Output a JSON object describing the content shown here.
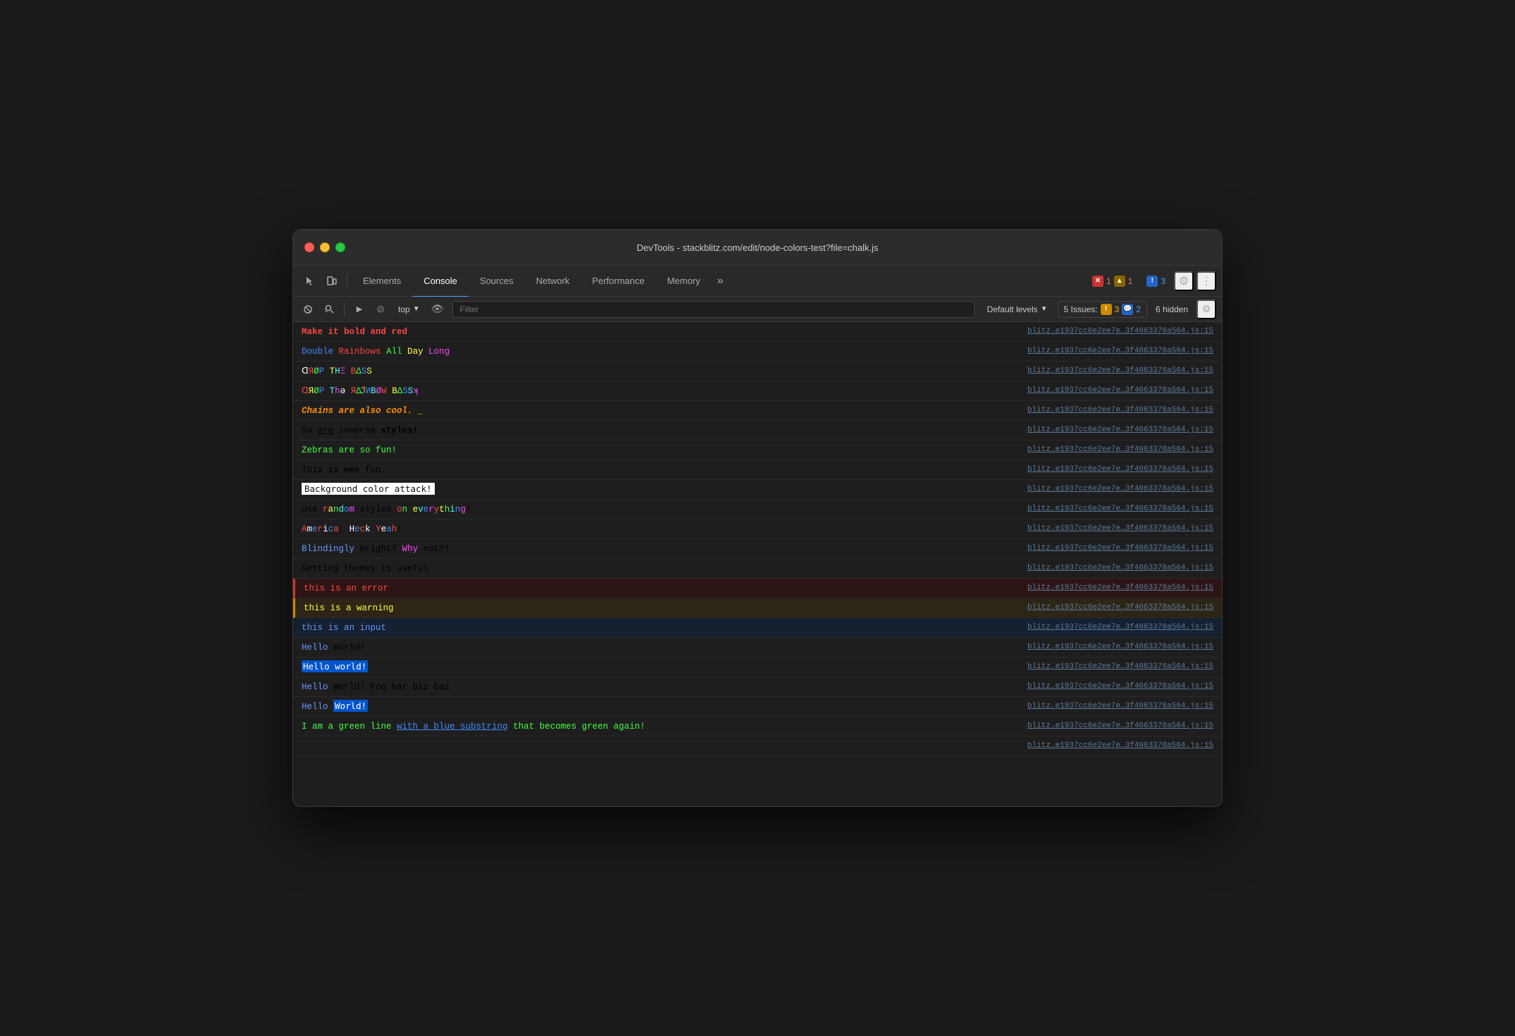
{
  "window": {
    "title": "DevTools - stackblitz.com/edit/node-colors-test?file=chalk.js"
  },
  "tabs": {
    "items": [
      {
        "id": "elements",
        "label": "Elements",
        "active": false
      },
      {
        "id": "console",
        "label": "Console",
        "active": true
      },
      {
        "id": "sources",
        "label": "Sources",
        "active": false
      },
      {
        "id": "network",
        "label": "Network",
        "active": false
      },
      {
        "id": "performance",
        "label": "Performance",
        "active": false
      },
      {
        "id": "memory",
        "label": "Memory",
        "active": false
      }
    ]
  },
  "toolbar": {
    "top_label": "top",
    "filter_placeholder": "Filter",
    "levels_label": "Default levels",
    "issues_label": "5 Issues:",
    "issues_warning_count": "3",
    "issues_info_count": "2",
    "hidden_label": "6 hidden"
  },
  "badges": {
    "error_icon": "✕",
    "error_count": "1",
    "warning_icon": "▲",
    "warning_count": "1",
    "info_icon": "!",
    "info_count": "3"
  },
  "source_link": "blitz.e1937cc6e2ee7e…3f4063378a564.js:15",
  "console_rows": [
    {
      "id": 1,
      "type": "normal",
      "text_html": "<span class='c-red c-bold'>Make it <span class='c-bold'>bold</span> and red</span>"
    },
    {
      "id": 2,
      "type": "normal",
      "text_html": "<span class='c-blue'>Double</span> <span class='c-red'>Rainbows</span> <span class='c-green'>All</span> <span class='c-yellow'>Day</span> <span class='c-magenta'>Long</span>"
    },
    {
      "id": 3,
      "type": "normal",
      "text_html": "<span class='c-white'>ᗡ</span><span class='c-red'>Я</span><span class='c-green'>Ø</span><span class='c-blue'>Ρ</span> <span class='c-yellow'>T</span><span class='c-cyan'>H</span><span class='c-magenta'>Ξ</span> <span class='c-red'>В</span><span class='c-green'>Δ</span><span class='c-blue'>S</span><span class='c-yellow'>S</span>"
    },
    {
      "id": 4,
      "type": "normal",
      "text_html": "<span class='c-red'>ᗡ</span><span class='c-yellow'>Я</span><span class='c-green'>Ø</span><span class='c-blue'>Ρ</span> <span class='c-cyan'>T</span><span class='c-magenta'>h</span><span class='c-white'>ə</span> <span class='c-red'>Я</span><span class='c-green'>Δ</span><span class='c-yellow'>ℐ</span><span class='c-blue'>И</span><span class='c-cyan'>В</span><span class='c-magenta'>Ø</span><span class='c-red'>W</span> <span class='c-yellow'>В</span><span class='c-green'>Δ</span><span class='c-blue'>S</span><span class='c-cyan'>S</span><span class='c-magenta'>ʞ</span>"
    },
    {
      "id": 5,
      "type": "normal",
      "text_html": "<span class='c-orange c-bold c-italic'>Chains are also cool.</span> <span class='c-orange c-italic'>_</span>"
    },
    {
      "id": 6,
      "type": "normal",
      "text_html": "<span>So <span class='c-underline'>are</span> inverse <span class='c-bold'>styles!</span></span>"
    },
    {
      "id": 7,
      "type": "normal",
      "text_html": "<span class='c-green'>Zebras are so fun!</span>"
    },
    {
      "id": 8,
      "type": "normal",
      "text_html": "<span>This is <span class='c-strikethrough'>not</span> fun.</span>"
    },
    {
      "id": 9,
      "type": "normal",
      "text_html": "<span style='background:#fff;color:#111;font-family:monospace;padding:1px 4px;'>Background color attack!</span>"
    },
    {
      "id": 10,
      "type": "normal",
      "text_html": "<span>Use </span><span class='c-red'>r</span><span class='c-yellow'>a</span><span class='c-green'>n</span><span class='c-cyan'>d</span><span class='c-blue'>o</span><span class='c-magenta'>m</span><span> styles </span><span class='c-red'>o</span><span class='c-green'>n</span><span> </span><span class='c-yellow'>e</span><span class='c-cyan'>v</span><span class='c-blue'>e</span><span class='c-magenta'>r</span><span class='c-red'>y</span><span class='c-yellow'>t</span><span class='c-green'>h</span><span class='c-cyan'>i</span><span class='c-blue'>n</span><span class='c-magenta'>g</span><span>!</span>"
    },
    {
      "id": 11,
      "type": "normal",
      "text_html": "<span class='c-red'>A</span><span class='c-white'>m</span><span class='c-blue'>e</span><span class='c-red'>r</span><span class='c-white'>i</span><span class='c-blue'>c</span><span class='c-red'>a</span><span>, </span><span class='c-white'>H</span><span class='c-blue'>e</span><span class='c-red'>c</span><span class='c-white'>k</span><span> </span><span class='c-red'>Y</span><span class='c-white'>e</span><span class='c-blue'>a</span><span class='c-red'>h</span><span>!</span>"
    },
    {
      "id": 12,
      "type": "normal",
      "text_html": "<span class='c-bright-blue'>Blindingly</span> <span>bright? </span><span class='c-magenta'>Why</span><span> not?!</span>"
    },
    {
      "id": 13,
      "type": "normal",
      "text_html": "<span>Setting themes is useful</span>"
    },
    {
      "id": 14,
      "type": "error",
      "text_html": "<span class='c-red'>this is an error</span>"
    },
    {
      "id": 15,
      "type": "warning",
      "text_html": "<span class='c-yellow'>this is a warning</span>"
    },
    {
      "id": 16,
      "type": "info",
      "text_html": "<span class='c-bright-blue'>this is an input</span>"
    },
    {
      "id": 17,
      "type": "normal",
      "text_html": "<span class='c-bright-blue'>Hello</span> <span>World!</span>"
    },
    {
      "id": 18,
      "type": "normal",
      "text_html": "<span style='background:#0055cc;color:#fff;padding:1px 2px;font-family:monospace;'>Hello world!</span>"
    },
    {
      "id": 19,
      "type": "normal",
      "text_html": "<span class='c-bright-blue'>Hello</span> <span>World! Foo bar biz baz</span>"
    },
    {
      "id": 20,
      "type": "normal",
      "text_html": "<span class='c-bright-blue'>Hello </span><span style='background:#0055cc;color:#fff;padding:1px 2px;font-family:monospace;'>World!</span>"
    },
    {
      "id": 21,
      "type": "normal",
      "text_html": "<span class='c-green'>I am a green line </span><span class='c-blue c-underline'>with a blue substring</span><span class='c-green'> that becomes green again!</span>"
    },
    {
      "id": 22,
      "type": "normal",
      "text_html": "<span></span>"
    }
  ]
}
